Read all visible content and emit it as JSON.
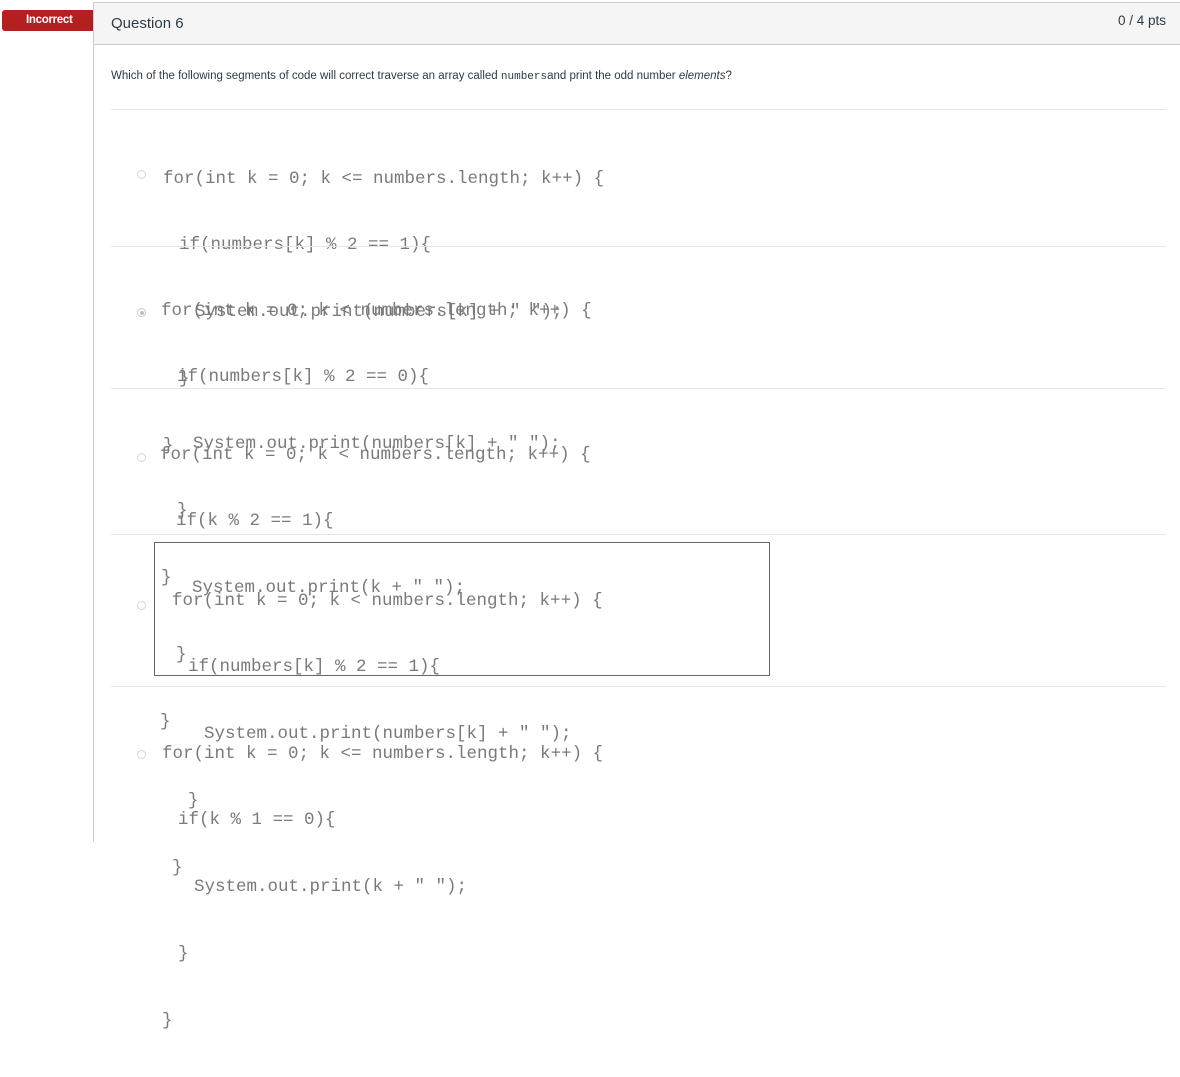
{
  "status_badge": "Incorrect",
  "question": {
    "title": "Question 6",
    "points": "0 / 4 pts",
    "text_before": "Which of the following segments of code will correct traverse an array called ",
    "text_code": "numbers",
    "text_middle": " and print the odd number ",
    "text_em": "elements",
    "text_after": "?"
  },
  "answers": [
    {
      "selected": false,
      "lines": [
        "for(int k = 0; k <= numbers.length; k++) {",
        "    if(numbers[k] % 2 == 1){",
        "        System.out.print(numbers[k] + \" \");",
        "    }",
        "}"
      ]
    },
    {
      "selected": true,
      "lines": [
        "for(int k = 0; k < numbers.length; k++) {",
        "    if(numbers[k] % 2 == 0){",
        "        System.out.print(numbers[k] + \" \");",
        "    }",
        "}"
      ]
    },
    {
      "selected": false,
      "lines": [
        "for(int k = 0; k < numbers.length; k++) {",
        "    if(k % 2 == 1){",
        "        System.out.print(k + \" \");",
        "    }",
        "}"
      ]
    },
    {
      "selected": false,
      "lines": [
        "for(int k = 0; k < numbers.length; k++) {",
        "    if(numbers[k] % 2 == 1){",
        "        System.out.print(numbers[k] + \" \");",
        "    }",
        "}"
      ]
    },
    {
      "selected": false,
      "lines": [
        "for(int k = 0; k <= numbers.length; k++) {",
        "    if(k % 1 == 0){",
        "        System.out.print(k + \" \");",
        "    }",
        "}"
      ]
    }
  ]
}
